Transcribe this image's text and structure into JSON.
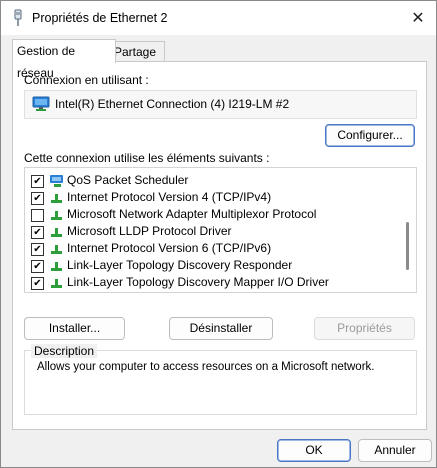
{
  "window": {
    "title": "Propriétés de Ethernet 2",
    "close_label": "✕"
  },
  "tabs": [
    {
      "label": "Gestion de réseau",
      "active": true
    },
    {
      "label": "Partage",
      "active": false
    }
  ],
  "connection": {
    "label": "Connexion en utilisant :",
    "adapter": "Intel(R) Ethernet Connection (4) I219-LM #2",
    "configure_label": "Configurer..."
  },
  "components": {
    "label": "Cette connexion utilise les éléments suivants :",
    "items": [
      {
        "label": "QoS Packet Scheduler",
        "checked": true,
        "icon": "qos-scheduler-icon"
      },
      {
        "label": "Internet Protocol Version 4 (TCP/IPv4)",
        "checked": true,
        "icon": "protocol-icon"
      },
      {
        "label": "Microsoft Network Adapter Multiplexor Protocol",
        "checked": false,
        "icon": "protocol-icon"
      },
      {
        "label": "Microsoft LLDP Protocol Driver",
        "checked": true,
        "icon": "protocol-icon"
      },
      {
        "label": "Internet Protocol Version 6 (TCP/IPv6)",
        "checked": true,
        "icon": "protocol-icon"
      },
      {
        "label": "Link-Layer Topology Discovery Responder",
        "checked": true,
        "icon": "protocol-icon"
      },
      {
        "label": "Link-Layer Topology Discovery Mapper I/O Driver",
        "checked": true,
        "icon": "protocol-icon"
      }
    ]
  },
  "actions": {
    "install_label": "Installer...",
    "uninstall_label": "Désinstaller",
    "properties_label": "Propriétés"
  },
  "description": {
    "label": "Description",
    "text": "Allows your computer to access resources on a Microsoft network."
  },
  "footer": {
    "ok_label": "OK",
    "cancel_label": "Annuler"
  },
  "colors": {
    "accent": "#4a76c7",
    "protocol_green": "#2e9e3a",
    "monitor_blue": "#2a7fd4"
  }
}
